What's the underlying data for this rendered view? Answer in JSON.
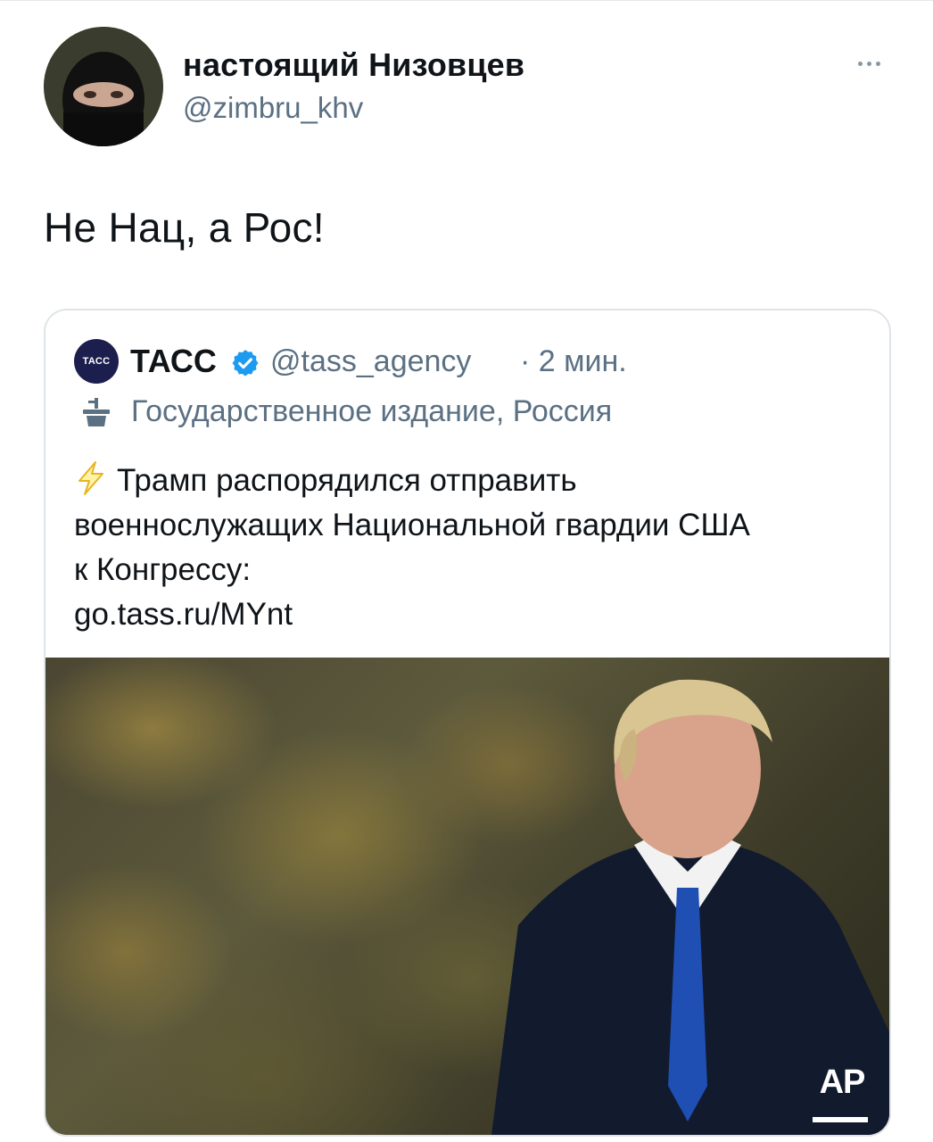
{
  "author": {
    "display_name": "настоящий Низовцев",
    "handle": "@zimbru_khv"
  },
  "tweet": {
    "text": "Не Нац, а Рос!"
  },
  "quoted": {
    "avatar_label": "ТАСС",
    "name": "ТАСС",
    "handle": "@tass_agency",
    "time": "· 2 мин.",
    "label": "Государственное издание, Россия",
    "body_lines": [
      "Трамп распорядился отправить",
      "военнослужащих Национальной гвардии США",
      "к Конгрессу:",
      "go.tass.ru/MYnt"
    ],
    "media_credit": "AP"
  },
  "icons": {
    "more": "more-dots-icon",
    "verified": "verified-badge-icon",
    "state_media": "state-media-podium-icon",
    "bolt": "lightning-bolt-icon"
  },
  "colors": {
    "text_primary": "#0f1419",
    "text_secondary": "#5b7083",
    "verified_blue": "#1d9bf0",
    "bolt_yellow": "#f4c430"
  }
}
